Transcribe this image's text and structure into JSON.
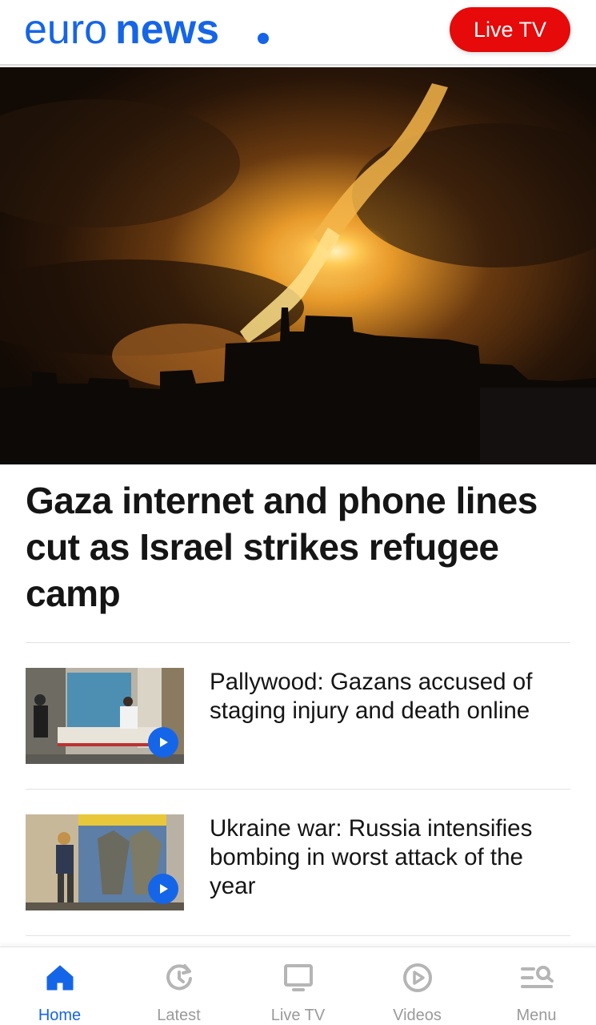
{
  "header": {
    "logo_text": "euronews.",
    "live_button_label": "Live TV",
    "brand_color": "#1565e8",
    "live_color": "#e60a0a"
  },
  "hero": {
    "image_icon": "night-explosion-photo",
    "headline": "Gaza internet and phone lines cut as Israel strikes refugee camp"
  },
  "stories": [
    {
      "title": "Pallywood: Gazans accused of staging injury and death online",
      "thumbnail": "hospital-photo",
      "has_video": true
    },
    {
      "title": "Ukraine war: Russia intensifies bombing in worst attack of the year",
      "thumbnail": "mural-photo",
      "has_video": true
    }
  ],
  "bottom_nav": {
    "items": [
      {
        "label": "Home",
        "icon": "home-icon",
        "active": true
      },
      {
        "label": "Latest",
        "icon": "latest-icon",
        "active": false
      },
      {
        "label": "Live TV",
        "icon": "tv-icon",
        "active": false
      },
      {
        "label": "Videos",
        "icon": "play-circle-icon",
        "active": false
      },
      {
        "label": "Menu",
        "icon": "menu-search-icon",
        "active": false
      }
    ]
  }
}
